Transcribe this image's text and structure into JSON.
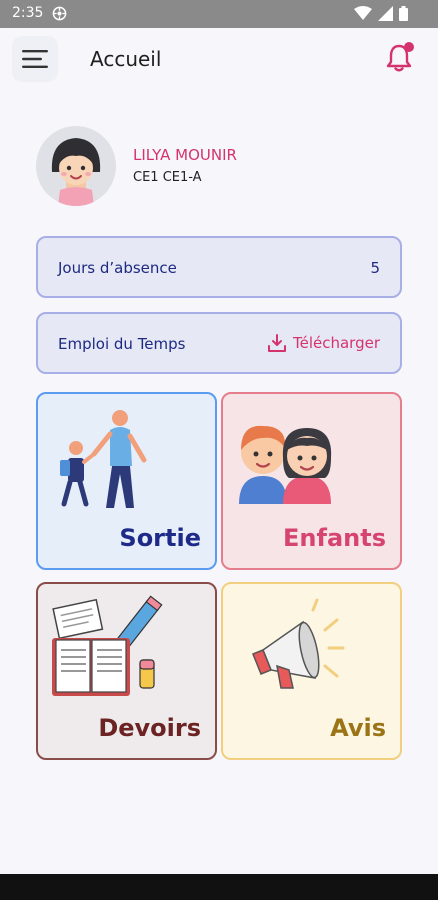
{
  "status_bar": {
    "time": "2:35"
  },
  "header": {
    "title": "Accueil"
  },
  "student": {
    "name": "LILYA MOUNIR",
    "class": "CE1 CE1-A"
  },
  "absence": {
    "label": "Jours d’absence",
    "value": "5"
  },
  "schedule": {
    "label": "Emploi  du Temps",
    "download_label": "Télécharger"
  },
  "tiles": [
    {
      "label": "Sortie"
    },
    {
      "label": "Enfants"
    },
    {
      "label": "Devoirs"
    },
    {
      "label": "Avis"
    }
  ],
  "colors": {
    "accent_pink": "#d5336b",
    "navy": "#1d2a80",
    "sortie_border": "#5b9bf0",
    "enfants_border": "#e57d8d",
    "devoirs_border": "#8a4b4b",
    "avis_border": "#f1cf7e"
  },
  "icons": [
    "menu-icon",
    "bell-icon",
    "notification-dot",
    "download-icon",
    "wifi-icon",
    "signal-icon",
    "battery-icon"
  ]
}
